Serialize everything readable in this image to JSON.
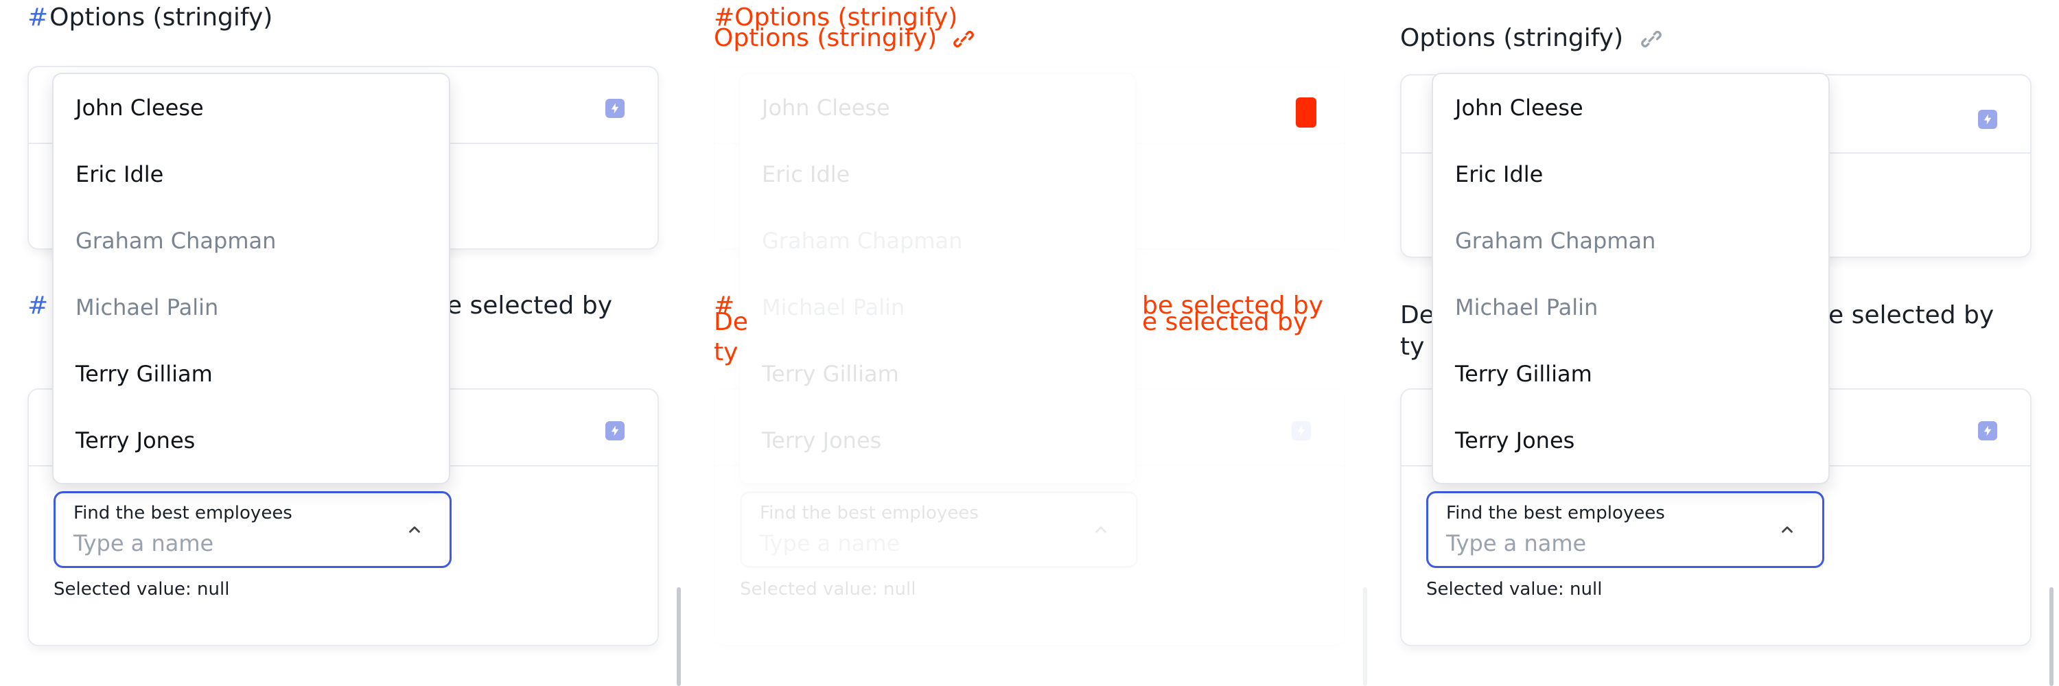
{
  "section1": {
    "title": "Options (stringify)"
  },
  "section2": {
    "title_left": "Define a custom filter. Options must be selected by",
    "title_right_line1": "Define a custom filter. Options must be selected by",
    "title_right_line2": "typing"
  },
  "left": {
    "title2_visible_prefix": "#",
    "title2_visible_suffix": "be selected by"
  },
  "middle": {
    "title1_line1": "#Options (stringify)",
    "title1_line2": "Options (stringify)",
    "title2_line1_a": "#",
    "title2_line1_b": "be selected by",
    "title2_line2_a": "De",
    "title2_line2_b": "e selected by",
    "title2_line3": "ty"
  },
  "right": {
    "title1": "Options (stringify)",
    "title2_a": "De",
    "title2_b": "e selected by",
    "title2_c": "ty"
  },
  "autocomplete": {
    "label": "Find the best employees",
    "placeholder": "Type a name",
    "selected_text": "Selected value: null"
  },
  "options": [
    {
      "label": "John Cleese",
      "disabled": false
    },
    {
      "label": "Eric Idle",
      "disabled": false
    },
    {
      "label": "Graham Chapman",
      "disabled": true
    },
    {
      "label": "Michael Palin",
      "disabled": true
    },
    {
      "label": "Terry Gilliam",
      "disabled": false
    },
    {
      "label": "Terry Jones",
      "disabled": false
    }
  ],
  "colors": {
    "accent": "#3b6cf0",
    "border": "#e7ebf0",
    "input_focus": "#3e5be3",
    "diff_red": "#ff3b00"
  }
}
